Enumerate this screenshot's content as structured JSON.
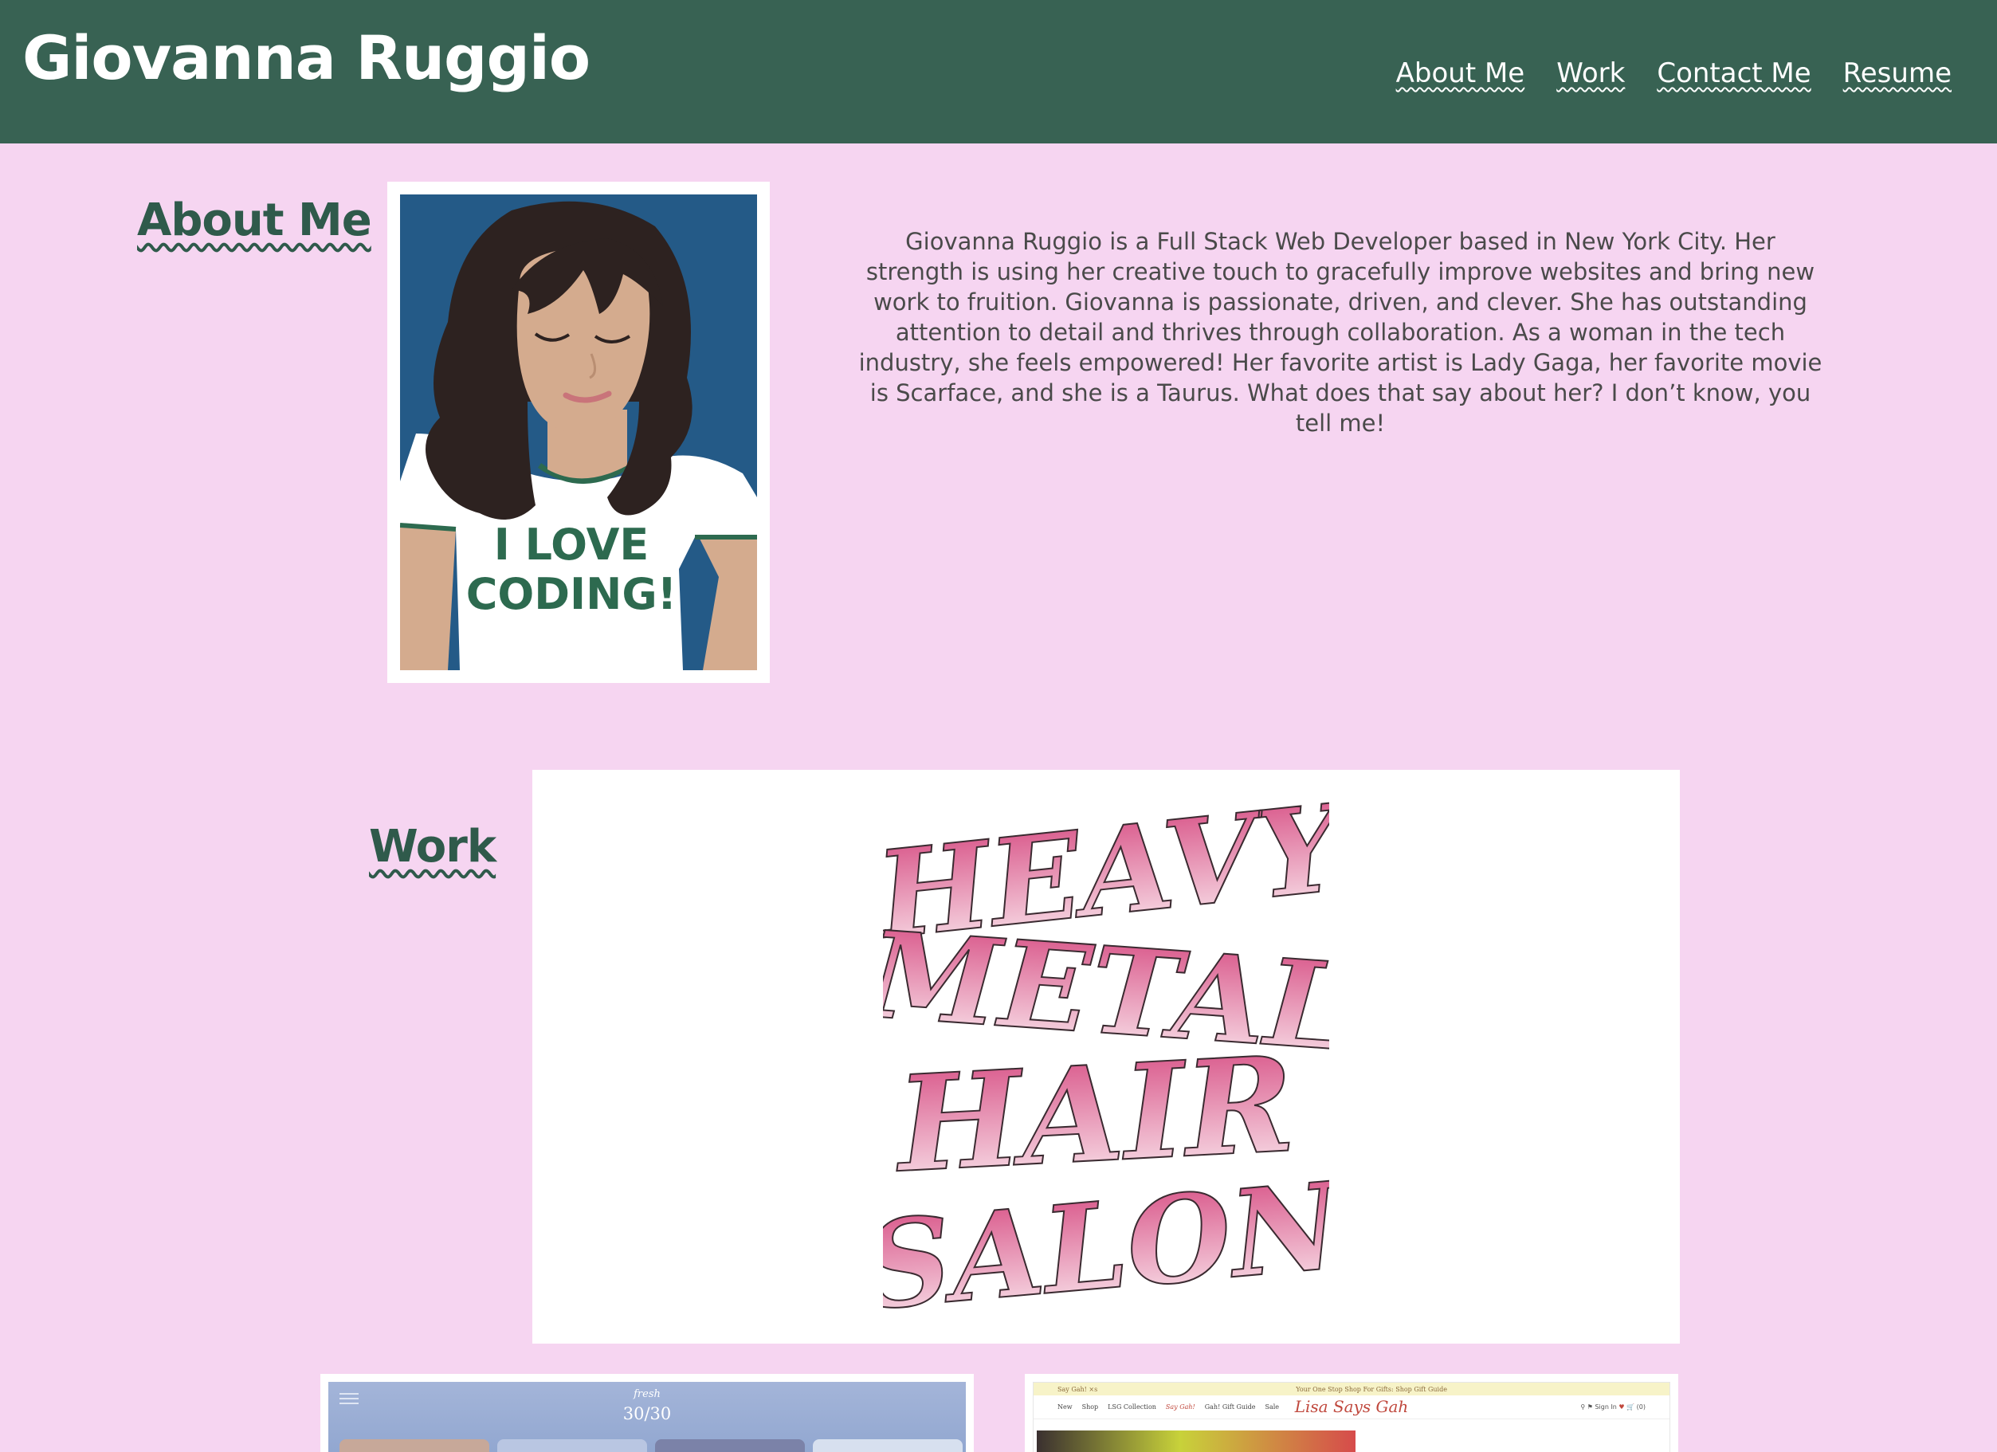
{
  "header": {
    "site_title": "Giovanna Ruggio",
    "nav": [
      "About Me",
      "Work",
      "Contact Me",
      "Resume"
    ]
  },
  "about": {
    "heading": "About Me",
    "portrait_shirt_text": "I LOVE CODING!",
    "bio": "Giovanna Ruggio is a Full Stack Web Developer based in New York City. Her strength is using her creative touch to gracefully improve websites and bring new work to fruition. Giovanna is passionate, driven, and clever. She has outstanding attention to detail and thrives through collaboration. As a woman in the tech industry, she feels empowered! Her favorite artist is Lady Gaga, her favorite movie is Scarface, and she is a Taurus. What does that say about her? I don’t know, you tell me!"
  },
  "work": {
    "heading": "Work",
    "featured_art_text": [
      "HEAVY",
      "METAL",
      "HAIR",
      "SALON"
    ],
    "thumb1": {
      "brand": "fresh",
      "promo": "30/30"
    },
    "thumb2": {
      "topbar_left": "Say Gah! ×s",
      "topbar_center": "Your One Stop Shop For Gifts: Shop Gift Guide",
      "nav": [
        "New",
        "Shop",
        "LSG Collection",
        "Say Gah!",
        "Gah! Gift Guide",
        "Sale"
      ],
      "logo": "Lisa Says Gah",
      "sign_in": "Sign In",
      "cart": "(0)"
    }
  },
  "colors": {
    "header_bg": "#386253",
    "page_bg": "#f6d5f1",
    "accent_green": "#2f5a4b",
    "art_pink": "#d5467e"
  }
}
